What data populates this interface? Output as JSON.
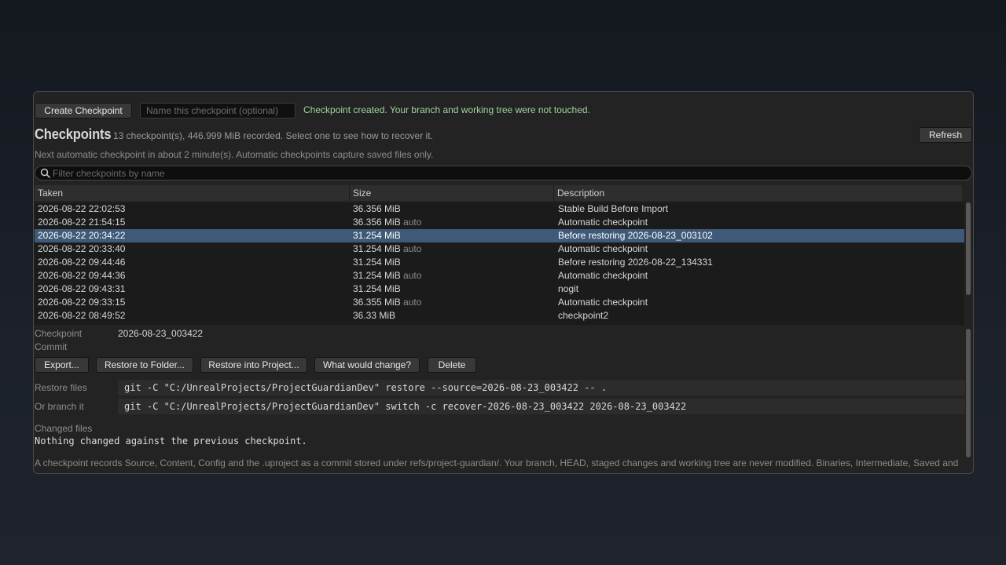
{
  "toolbar": {
    "create_label": "Create Checkpoint",
    "name_placeholder": "Name this checkpoint (optional)",
    "status_message": "Checkpoint created. Your branch and working tree were not touched.",
    "refresh_label": "Refresh"
  },
  "header": {
    "title": "Checkpoints",
    "summary": "13 checkpoint(s), 446.999 MiB recorded. Select one to see how to recover it.",
    "next_auto": "Next automatic checkpoint in about 2 minute(s). Automatic checkpoints capture saved files only."
  },
  "filter": {
    "placeholder": "Filter checkpoints by name"
  },
  "table": {
    "columns": [
      "Taken",
      "Size",
      "Description"
    ],
    "rows": [
      {
        "taken": "2026-08-22 22:02:53",
        "size": "36.356 MiB",
        "tag": "",
        "description": "Stable Build Before Import",
        "selected": false
      },
      {
        "taken": "2026-08-22 21:54:15",
        "size": "36.356 MiB",
        "tag": "auto",
        "description": "Automatic checkpoint",
        "selected": false
      },
      {
        "taken": "2026-08-22 20:34:22",
        "size": "31.254 MiB",
        "tag": "",
        "description": "Before restoring 2026-08-23_003102",
        "selected": true
      },
      {
        "taken": "2026-08-22 20:33:40",
        "size": "31.254 MiB",
        "tag": "auto",
        "description": "Automatic checkpoint",
        "selected": false
      },
      {
        "taken": "2026-08-22 09:44:46",
        "size": "31.254 MiB",
        "tag": "",
        "description": "Before restoring 2026-08-22_134331",
        "selected": false
      },
      {
        "taken": "2026-08-22 09:44:36",
        "size": "31.254 MiB",
        "tag": "auto",
        "description": "Automatic checkpoint",
        "selected": false
      },
      {
        "taken": "2026-08-22 09:43:31",
        "size": "31.254 MiB",
        "tag": "",
        "description": "nogit",
        "selected": false
      },
      {
        "taken": "2026-08-22 09:33:15",
        "size": "36.355 MiB",
        "tag": "auto",
        "description": "Automatic checkpoint",
        "selected": false
      },
      {
        "taken": "2026-08-22 08:49:52",
        "size": "36.33 MiB",
        "tag": "",
        "description": "checkpoint2",
        "selected": false
      }
    ]
  },
  "details": {
    "checkpoint_label": "Checkpoint",
    "checkpoint_value": "2026-08-23_003422",
    "commit_label": "Commit",
    "commit_value": "",
    "actions": {
      "export": "Export...",
      "restore_folder": "Restore to Folder...",
      "restore_project": "Restore into Project...",
      "what_change": "What would change?",
      "delete": "Delete"
    },
    "restore_files_label": "Restore files",
    "restore_files_cmd": "git -C \"C:/UnrealProjects/ProjectGuardianDev\" restore --source=2026-08-23_003422 -- .",
    "branch_label": "Or branch it",
    "branch_cmd": "git -C \"C:/UnrealProjects/ProjectGuardianDev\" switch -c recover-2026-08-23_003422 2026-08-23_003422",
    "changed_files_label": "Changed files",
    "changed_files_text": "Nothing changed against the previous checkpoint.",
    "footnote": "A checkpoint records Source, Content, Config and the .uproject as a commit stored under refs/project-guardian/. Your branch, HEAD, staged changes and working tree are never modified. Binaries, Intermediate, Saved and"
  },
  "colors": {
    "selected_row": "#3e5a78",
    "status_message": "#9fd39b",
    "panel_background": "#232323"
  },
  "icons": {
    "filter": "search-icon"
  }
}
